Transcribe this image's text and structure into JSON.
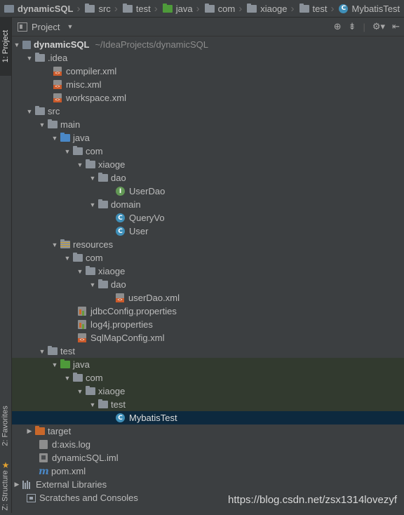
{
  "breadcrumbs": [
    {
      "label": "dynamicSQL",
      "icon": "project-icon"
    },
    {
      "label": "src",
      "icon": "folder-icon"
    },
    {
      "label": "test",
      "icon": "folder-icon"
    },
    {
      "label": "java",
      "icon": "folder-icon-green"
    },
    {
      "label": "com",
      "icon": "folder-icon"
    },
    {
      "label": "xiaoge",
      "icon": "folder-icon"
    },
    {
      "label": "test",
      "icon": "folder-icon"
    },
    {
      "label": "MybatisTest",
      "icon": "class-icon"
    }
  ],
  "tool_tabs": {
    "project": "1: Project",
    "favorites": "2: Favorites",
    "structure": "Z: Structure"
  },
  "toolbar": {
    "title": "Project",
    "icons": [
      "locate-icon",
      "collapse-icon",
      "settings-icon",
      "hide-icon"
    ]
  },
  "tree": {
    "root": {
      "name": "dynamicSQL",
      "path": "~/IdeaProjects/dynamicSQL"
    },
    "idea": ".idea",
    "compiler_xml": "compiler.xml",
    "misc_xml": "misc.xml",
    "workspace_xml": "workspace.xml",
    "src": "src",
    "main": "main",
    "java_main": "java",
    "com_main": "com",
    "xiaoge_main": "xiaoge",
    "dao": "dao",
    "userdao": "UserDao",
    "domain": "domain",
    "queryvo": "QueryVo",
    "user": "User",
    "resources": "resources",
    "com_res": "com",
    "xiaoge_res": "xiaoge",
    "dao_res": "dao",
    "userdao_xml": "userDao.xml",
    "jdbc": "jdbcConfig.properties",
    "log4j": "log4j.properties",
    "sqlmap": "SqlMapConfig.xml",
    "test": "test",
    "java_test": "java",
    "com_test": "com",
    "xiaoge_test": "xiaoge",
    "test_pkg": "test",
    "mybatistest": "MybatisTest",
    "target": "target",
    "axislog": "d:axis.log",
    "iml": "dynamicSQL.iml",
    "pom": "pom.xml",
    "extlibs": "External Libraries",
    "scratches": "Scratches and Consoles"
  },
  "badges": {
    "class": "C",
    "interface": "I"
  },
  "watermark": "https://blog.csdn.net/zsx1314lovezyf",
  "colors": {
    "background": "#3c3f41",
    "selection": "#0d293e",
    "test_highlight": "#323a2f",
    "class_badge": "#3f8fb8",
    "interface_badge": "#629755"
  }
}
